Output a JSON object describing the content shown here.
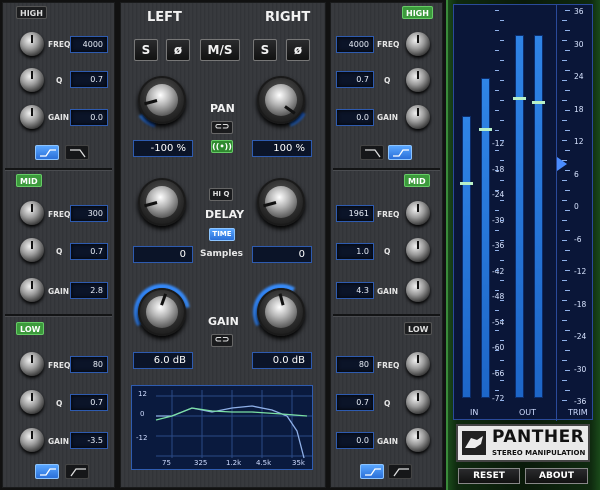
{
  "left_column": {
    "bands": [
      {
        "tag": "HIGH",
        "freq": "4000",
        "q": "0.7",
        "gain": "0.0"
      },
      {
        "tag": "MID",
        "freq": "300",
        "q": "0.7",
        "gain": "2.8"
      },
      {
        "tag": "LOW",
        "freq": "80",
        "q": "0.7",
        "gain": "-3.5"
      }
    ]
  },
  "right_column": {
    "bands": [
      {
        "tag": "HIGH",
        "freq": "4000",
        "q": "0.7",
        "gain": "0.0"
      },
      {
        "tag": "MID",
        "freq": "1961",
        "q": "1.0",
        "gain": "4.3"
      },
      {
        "tag": "LOW",
        "freq": "80",
        "q": "0.7",
        "gain": "0.0"
      }
    ]
  },
  "param_labels": {
    "freq": "FREQ",
    "q": "Q",
    "gain": "GAIN"
  },
  "center": {
    "left_title": "LEFT",
    "right_title": "RIGHT",
    "solo_left": "S",
    "phase_left": "ø",
    "ms_button": "M/S",
    "solo_right": "S",
    "phase_right": "ø",
    "pan_label": "PAN",
    "pan_left_value": "-100 %",
    "pan_right_value": "100 %",
    "hiq_label": "HI Q",
    "delay_label": "DELAY",
    "time_button": "TIME",
    "delay_left_value": "0",
    "delay_unit": "Samples",
    "delay_right_value": "0",
    "gain_label": "GAIN",
    "gain_left_value": "6.0 dB",
    "gain_right_value": "0.0 dB"
  },
  "eq_graph": {
    "y_labels": [
      "12",
      "0",
      "-12"
    ],
    "x_labels": [
      "75",
      "325",
      "1.2k",
      "4.5k",
      "35k"
    ]
  },
  "meters": {
    "scale_left": [
      "-12",
      "-18",
      "-24",
      "-30",
      "-36",
      "-42",
      "-48",
      "-54",
      "-60",
      "-66",
      "-72"
    ],
    "scale_right": [
      "36",
      "30",
      "24",
      "18",
      "12",
      "6",
      "0",
      "-6",
      "-12",
      "-18",
      "-24",
      "-30",
      "-36"
    ],
    "labels": {
      "in": "IN",
      "out": "OUT",
      "trim": "TRIM"
    },
    "in_levels": [
      0.73,
      0.83
    ],
    "out_levels": [
      0.94,
      0.94
    ]
  },
  "brand": {
    "name": "PANTHER",
    "subtitle": "STEREO MANIPULATION"
  },
  "footer": {
    "reset": "RESET",
    "about": "ABOUT"
  }
}
